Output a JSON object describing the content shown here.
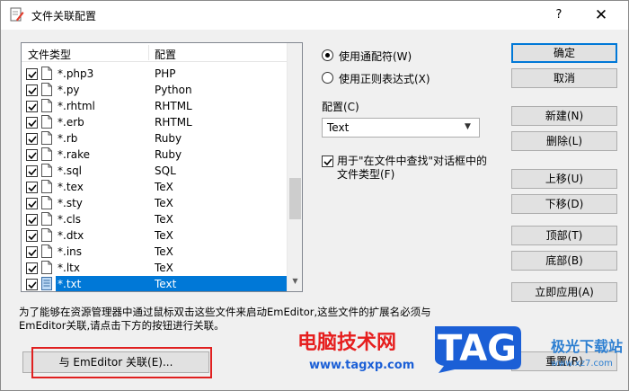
{
  "window": {
    "title": "文件关联配置",
    "help": "?",
    "close": "✕"
  },
  "list": {
    "columns": {
      "type": "文件类型",
      "config": "配置"
    },
    "rows": [
      {
        "name": "*.php3",
        "config": "PHP",
        "checked": true,
        "selected": false
      },
      {
        "name": "*.py",
        "config": "Python",
        "checked": true,
        "selected": false
      },
      {
        "name": "*.rhtml",
        "config": "RHTML",
        "checked": true,
        "selected": false
      },
      {
        "name": "*.erb",
        "config": "RHTML",
        "checked": true,
        "selected": false
      },
      {
        "name": "*.rb",
        "config": "Ruby",
        "checked": true,
        "selected": false
      },
      {
        "name": "*.rake",
        "config": "Ruby",
        "checked": true,
        "selected": false
      },
      {
        "name": "*.sql",
        "config": "SQL",
        "checked": true,
        "selected": false
      },
      {
        "name": "*.tex",
        "config": "TeX",
        "checked": true,
        "selected": false
      },
      {
        "name": "*.sty",
        "config": "TeX",
        "checked": true,
        "selected": false
      },
      {
        "name": "*.cls",
        "config": "TeX",
        "checked": true,
        "selected": false
      },
      {
        "name": "*.dtx",
        "config": "TeX",
        "checked": true,
        "selected": false
      },
      {
        "name": "*.ins",
        "config": "TeX",
        "checked": true,
        "selected": false
      },
      {
        "name": "*.ltx",
        "config": "TeX",
        "checked": true,
        "selected": false
      },
      {
        "name": "*.txt",
        "config": "Text",
        "checked": true,
        "selected": true
      }
    ]
  },
  "options": {
    "wildcard": "使用通配符(W)",
    "wildcard_selected": true,
    "regex": "使用正则表达式(X)",
    "config_label": "配置(C)",
    "config_value": "Text",
    "find_check_line1": "用于\"在文件中查找\"对话框中的",
    "find_check_line2": "文件类型(F)",
    "find_checked": true
  },
  "buttons": {
    "ok": "确定",
    "cancel": "取消",
    "new": "新建(N)",
    "delete": "删除(L)",
    "up": "上移(U)",
    "down": "下移(D)",
    "top": "顶部(T)",
    "bottom": "底部(B)",
    "apply": "立即应用(A)",
    "reset": "重置(R)",
    "associate": "与 EmEditor 关联(E)..."
  },
  "help_text": {
    "line1": "为了能够在资源管理器中通过鼠标双击这些文件来启动EmEditor,这些文件的扩展名必须与",
    "line2": "EmEditor关联,请点击下方的按钮进行关联。"
  },
  "watermarks": {
    "site_cn": "电脑技术网",
    "site_url": "www.tagxp.com",
    "tag": "TAG",
    "right_cn": "极光下载站",
    "right_url": "www.xz7.com"
  },
  "colors": {
    "accent": "#0078d7",
    "highlight_box": "#e02020",
    "tag_blue": "#1b5fd6"
  }
}
